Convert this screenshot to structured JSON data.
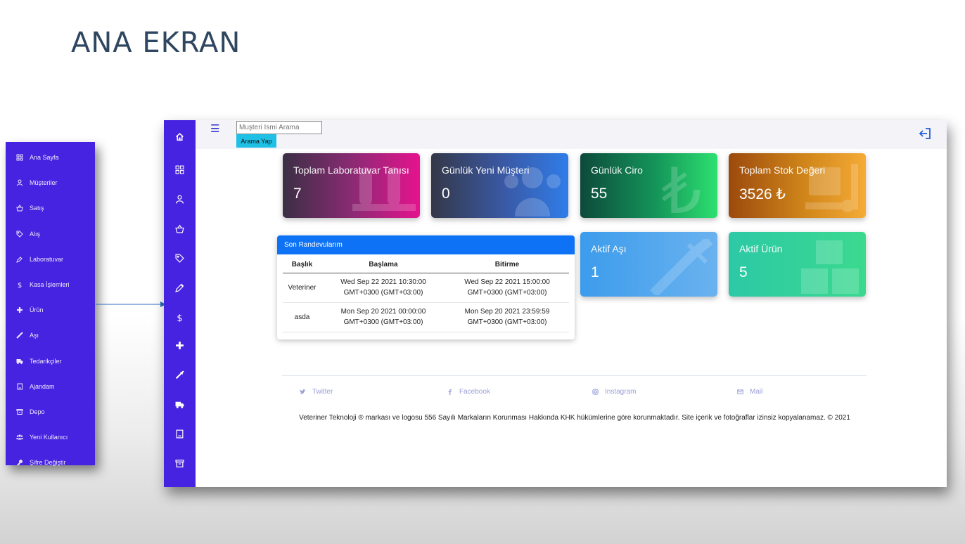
{
  "slide": {
    "title": "ANA EKRAN"
  },
  "side_menu": {
    "items": [
      {
        "label": "Ana Sayfa",
        "icon": "grid-icon"
      },
      {
        "label": "Müşteriler",
        "icon": "user-icon"
      },
      {
        "label": "Satış",
        "icon": "basket-icon"
      },
      {
        "label": "Alış",
        "icon": "tag-icon"
      },
      {
        "label": "Laboratuvar",
        "icon": "eyedropper-icon"
      },
      {
        "label": "Kasa İşlemleri",
        "icon": "dollar-icon"
      },
      {
        "label": "Ürün",
        "icon": "plus-icon"
      },
      {
        "label": "Aşı",
        "icon": "syringe-icon"
      },
      {
        "label": "Tedarikçiler",
        "icon": "truck-icon"
      },
      {
        "label": "Ajandam",
        "icon": "notebook-icon"
      },
      {
        "label": "Depo",
        "icon": "archive-icon"
      },
      {
        "label": "Yeni Kullanıcı",
        "icon": "users-icon"
      },
      {
        "label": "Şifre Değiştir",
        "icon": "key-icon"
      }
    ]
  },
  "rail": {
    "icons": [
      "home-icon",
      "grid-icon",
      "user-icon",
      "basket-icon",
      "tag-icon",
      "eyedropper-icon",
      "dollar-icon",
      "plus-icon",
      "syringe-icon",
      "truck-icon",
      "notebook-icon",
      "archive-icon"
    ]
  },
  "topbar": {
    "search_placeholder": "Muşteri İsmi Arama",
    "search_button": "Arama Yap"
  },
  "cards": [
    {
      "title": "Toplam Laboratuvar Tanısı",
      "value": "7"
    },
    {
      "title": "Günlük Yeni Müşteri",
      "value": "0"
    },
    {
      "title": "Günlük Ciro",
      "value": "55"
    },
    {
      "title": "Toplam Stok Değeri",
      "value": "3526 ₺"
    },
    {
      "title": "Aktif Aşı",
      "value": "1"
    },
    {
      "title": "Aktif Ürün",
      "value": "5"
    }
  ],
  "appointments": {
    "title": "Son Randevularım",
    "headers": [
      "Başlık",
      "Başlama",
      "Bitirme"
    ],
    "rows": [
      {
        "title": "Veteriner",
        "start1": "Wed Sep 22 2021 10:30:00",
        "start2": "GMT+0300 (GMT+03:00)",
        "end1": "Wed Sep 22 2021 15:00:00",
        "end2": "GMT+0300 (GMT+03:00)"
      },
      {
        "title": "asda",
        "start1": "Mon Sep 20 2021 00:00:00",
        "start2": "GMT+0300 (GMT+03:00)",
        "end1": "Mon Sep 20 2021 23:59:59",
        "end2": "GMT+0300 (GMT+03:00)"
      }
    ]
  },
  "footer": {
    "social": [
      "Twitter",
      "Facebook",
      "Instagram",
      "Mail"
    ],
    "legal": "Veteriner Teknoloji ® markası ve logosu 556 Sayılı Markaların Korunması Hakkında KHK hükümlerine göre korunmaktadır. Site içerik ve fotoğraflar izinsiz kopyalanamaz. © 2021"
  },
  "colors": {
    "sidebar": "#4623e0",
    "primary_blue": "#0d72f5",
    "search_button": "#1fc0e6"
  }
}
